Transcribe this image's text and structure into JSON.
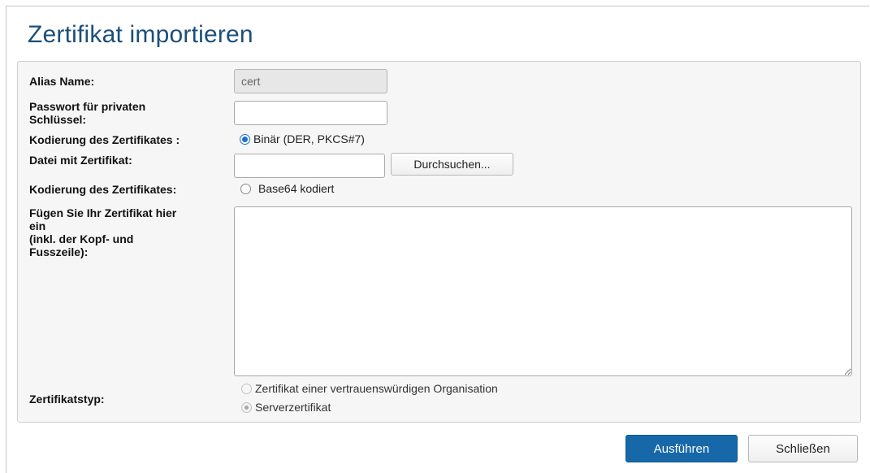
{
  "dialog": {
    "title": "Zertifikat importieren"
  },
  "form": {
    "alias": {
      "label": "Alias Name:",
      "value": "cert"
    },
    "password": {
      "label_line1": "Passwort für privaten",
      "label_line2": "Schlüssel:",
      "value": ""
    },
    "encoding_binary": {
      "label": "Kodierung des Zertifikates :",
      "option": "Binär (DER, PKCS#7)",
      "selected": true
    },
    "file": {
      "label": "Datei mit Zertifikat:",
      "value": "",
      "browse_label": "Durchsuchen..."
    },
    "encoding_base64": {
      "label": "Kodierung des Zertifikates:",
      "option": "Base64 kodiert",
      "selected": false
    },
    "paste": {
      "label_line1": "Fügen Sie Ihr Zertifikat hier",
      "label_line2": "ein",
      "label_line3": "(inkl. der Kopf- und",
      "label_line4": "Fusszeile):",
      "value": ""
    },
    "cert_type": {
      "label": "Zertifikatstyp:",
      "options": [
        {
          "label": "Zertifikat einer vertrauenswürdigen Organisation",
          "selected": false,
          "disabled": true
        },
        {
          "label": "Serverzertifikat",
          "selected": true,
          "disabled": true
        }
      ]
    }
  },
  "footer": {
    "execute_label": "Ausführen",
    "close_label": "Schließen"
  },
  "colors": {
    "title": "#1b4f7a",
    "primary_button": "#1768a8",
    "radio_accent": "#1d6fd0"
  }
}
